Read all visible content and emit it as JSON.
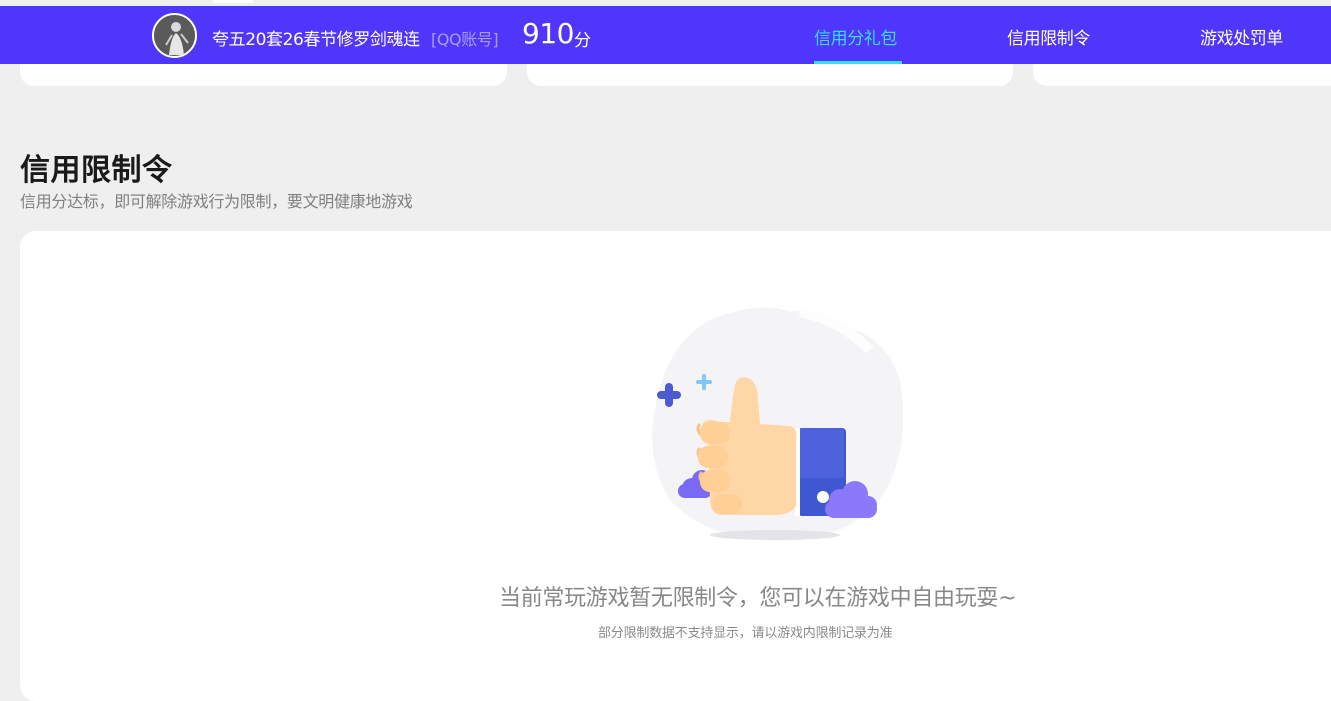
{
  "header": {
    "nickname": "夸五20套26春节修罗剑魂连",
    "account_type": "[QQ账号]",
    "score": "910",
    "score_unit": "分",
    "nav": [
      {
        "label": "信用分礼包",
        "active": true
      },
      {
        "label": "信用限制令",
        "active": false
      },
      {
        "label": "游戏处罚单",
        "active": false
      }
    ]
  },
  "section": {
    "title": "信用限制令",
    "subtitle": "信用分达标，即可解除游戏行为限制，要文明健康地游戏"
  },
  "empty_state": {
    "icon": "thumbs-up-illustration",
    "message": "当前常玩游戏暂无限制令，您可以在游戏中自由玩耍~",
    "note": "部分限制数据不支持显示，请以游戏内限制记录为准"
  },
  "colors": {
    "navbar": "#5035fb",
    "active_tab": "#35dff0",
    "background": "#efefef"
  }
}
